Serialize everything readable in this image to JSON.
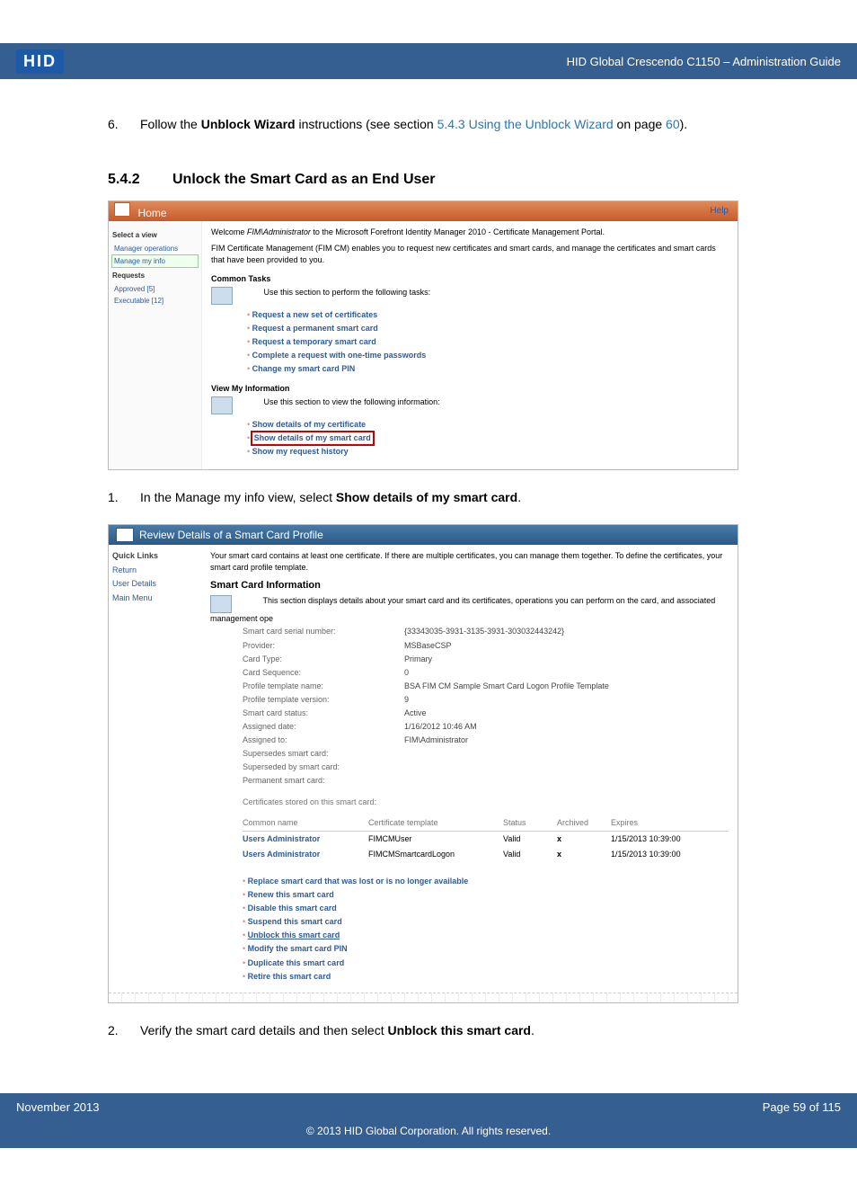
{
  "header": {
    "logo_text": "HID",
    "title": "HID Global Crescendo C1150  – Administration Guide"
  },
  "body": {
    "step6_num": "6.",
    "step6_pre": "Follow the ",
    "step6_bold": "Unblock Wizard",
    "step6_mid": " instructions (see section ",
    "step6_link": "5.4.3 Using the Unblock Wizard",
    "step6_mid2": " on page ",
    "step6_pagelink": "60",
    "step6_end": ").",
    "sec_num": "5.4.2",
    "sec_title": "Unlock the Smart Card as an End User",
    "step1_num": "1.",
    "step1_pre": "In the Manage my info view, select ",
    "step1_bold": "Show details of my smart card",
    "step1_end": ".",
    "step2_num": "2.",
    "step2_pre": "Verify the smart card details and then select ",
    "step2_bold": "Unblock this smart card",
    "step2_end": "."
  },
  "shot1": {
    "home": "Home",
    "help": "Help",
    "left": {
      "select_view": "Select a view",
      "manager_ops": "Manager operations",
      "manage_my_info": "Manage my info",
      "requests": "Requests",
      "approved": "Approved [5]",
      "executable": "Executable [12]"
    },
    "welcome_pre": "Welcome ",
    "welcome_user": "FIM\\Administrator",
    "welcome_post": " to the Microsoft Forefront Identity Manager 2010 - Certificate Management Portal.",
    "desc": "FIM Certificate Management (FIM CM) enables you to request new certificates and smart cards, and manage the certificates and smart cards that have been provided to you.",
    "common_tasks": "Common Tasks",
    "ct_desc": "Use this section to perform the following tasks:",
    "ct_items": {
      "a": "Request a new set of certificates",
      "b": "Request a permanent smart card",
      "c": "Request a temporary smart card",
      "d": "Complete a request with one-time passwords",
      "e": "Change my smart card PIN"
    },
    "view_my_info": "View My Information",
    "vi_desc": "Use this section to view the following information:",
    "vi_items": {
      "a": "Show details of my certificate",
      "b": "Show details of my smart card",
      "c": "Show my request history"
    }
  },
  "shot2": {
    "title": "Review Details of a Smart Card Profile",
    "left": {
      "ql": "Quick Links",
      "return": "Return",
      "user_details": "User Details",
      "main_menu": "Main Menu"
    },
    "intro": "Your smart card contains at least one certificate. If there are multiple certificates, you can manage them together. To define the certificates, your smart card profile template.",
    "info_h": "Smart Card Information",
    "info_desc": "This section displays details about your smart card and its certificates, operations you can perform on the card, and associated management ope",
    "kv": {
      "serial_k": "Smart card serial number:",
      "serial_v": "{33343035-3931-3135-3931-303032443242}",
      "provider_k": "Provider:",
      "provider_v": "MSBaseCSP",
      "cardtype_k": "Card Type:",
      "cardtype_v": "Primary",
      "cardseq_k": "Card Sequence:",
      "cardseq_v": "0",
      "ptname_k": "Profile template name:",
      "ptname_v": "BSA FIM CM Sample Smart Card Logon Profile Template",
      "ptver_k": "Profile template version:",
      "ptver_v": "9",
      "status_k": "Smart card status:",
      "status_v": "Active",
      "assigned_date_k": "Assigned date:",
      "assigned_date_v": "1/16/2012 10:46 AM",
      "assigned_to_k": "Assigned to:",
      "assigned_to_v": "FIM\\Administrator",
      "supersedes_k": "Supersedes smart card:",
      "superseded_by_k": "Superseded by smart card:",
      "permanent_k": "Permanent smart card:"
    },
    "cert_section": "Certificates stored on this smart card:",
    "cert_headers": {
      "cn": "Common name",
      "tpl": "Certificate template",
      "st": "Status",
      "ar": "Archived",
      "ex": "Expires"
    },
    "cert_rows": [
      {
        "cn": "Users Administrator",
        "tpl": "FIMCMUser",
        "st": "Valid",
        "ar": "x",
        "ex": "1/15/2013 10:39:00"
      },
      {
        "cn": "Users Administrator",
        "tpl": "FIMCMSmartcardLogon",
        "st": "Valid",
        "ar": "x",
        "ex": "1/15/2013 10:39:00"
      }
    ],
    "ops": {
      "a": "Replace smart card that was lost or is no longer available",
      "b": "Renew this smart card",
      "c": "Disable this smart card",
      "d": "Suspend this smart card",
      "e": "Unblock this smart card",
      "f": "Modify the smart card PIN",
      "g": "Duplicate this smart card",
      "h": "Retire this smart card"
    }
  },
  "footer": {
    "left": "November 2013",
    "right": "Page 59 of 115",
    "copyright": "© 2013 HID Global Corporation. All rights reserved."
  }
}
